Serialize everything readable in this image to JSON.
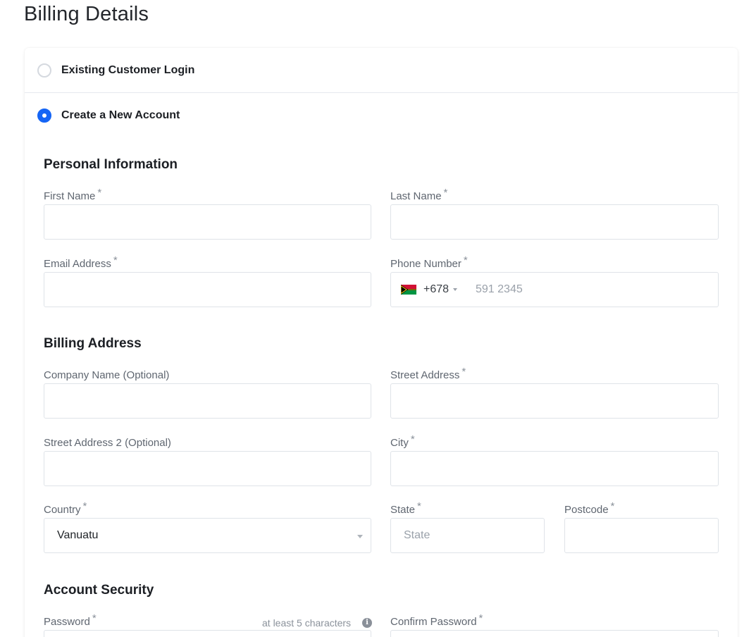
{
  "page": {
    "title": "Billing Details"
  },
  "account_options": {
    "existing": {
      "label": "Existing Customer Login",
      "selected": false
    },
    "new": {
      "label": "Create a New Account",
      "selected": true
    }
  },
  "sections": {
    "personal": "Personal Information",
    "billing": "Billing Address",
    "security": "Account Security"
  },
  "required_marker": "*",
  "fields": {
    "first_name": {
      "label": "First Name",
      "value": ""
    },
    "last_name": {
      "label": "Last Name",
      "value": ""
    },
    "email": {
      "label": "Email Address",
      "value": ""
    },
    "phone": {
      "label": "Phone Number",
      "dial_code": "+678",
      "country_flag": "vanuatu-flag-icon",
      "placeholder": "591 2345",
      "value": ""
    },
    "company": {
      "label": "Company Name (Optional)",
      "value": ""
    },
    "street": {
      "label": "Street Address",
      "value": ""
    },
    "street2": {
      "label": "Street Address 2 (Optional)",
      "value": ""
    },
    "city": {
      "label": "City",
      "value": ""
    },
    "country": {
      "label": "Country",
      "selected": "Vanuatu"
    },
    "state": {
      "label": "State",
      "placeholder": "State",
      "value": ""
    },
    "postcode": {
      "label": "Postcode",
      "value": ""
    },
    "password": {
      "label": "Password",
      "hint": "at least 5 characters"
    },
    "confirm_password": {
      "label": "Confirm Password"
    }
  },
  "colors": {
    "accent": "#1565f5",
    "border": "#dfe3e8",
    "label": "#5f6670"
  }
}
